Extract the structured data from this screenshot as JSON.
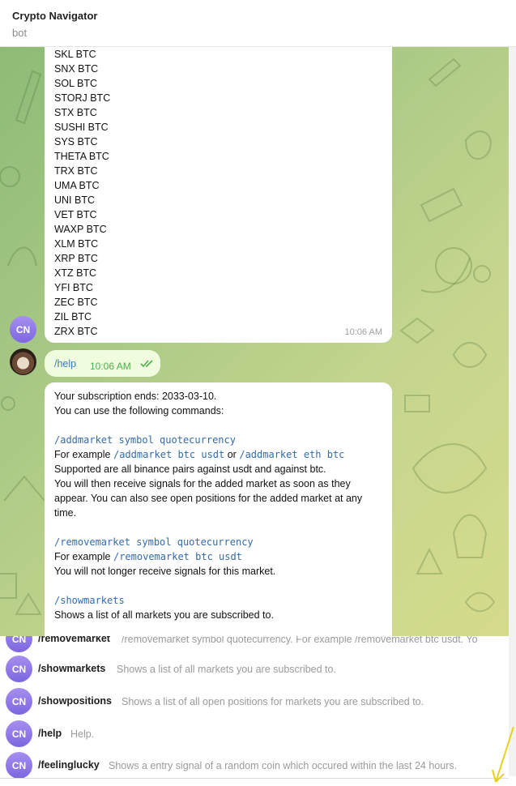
{
  "header": {
    "title": "Crypto Navigator",
    "subtitle": "bot"
  },
  "bot_avatar": "CN",
  "message1": {
    "lines": [
      "SKL BTC",
      "SNX BTC",
      "SOL BTC",
      "STORJ BTC",
      "STX BTC",
      "SUSHI BTC",
      "SYS BTC",
      "THETA BTC",
      "TRX BTC",
      "UMA BTC",
      "UNI BTC",
      "VET BTC",
      "WAXP BTC",
      "XLM BTC",
      "XRP BTC",
      "XTZ BTC",
      "YFI BTC",
      "ZEC BTC",
      "ZIL BTC",
      "ZRX BTC"
    ],
    "time": "10:06 AM"
  },
  "message2": {
    "text": "/help",
    "time": "10:06 AM"
  },
  "message3": {
    "line1": "Your subscription ends: 2033-03-10.",
    "line2": "You can use the following commands:",
    "addmarket_cmd": "/addmarket symbol quotecurrency",
    "addmarket_example_prefix": "For example",
    "addmarket_example1": "/addmarket btc usdt",
    "addmarket_example_or": "or",
    "addmarket_example2": "/addmarket eth btc",
    "addmarket_desc1": "Supported are all binance pairs against usdt and against btc.",
    "addmarket_desc2": "You will then receive signals for the added market as soon as they appear. You can also see open positions for the added market at any time.",
    "removemarket_cmd": "/removemarket symbol quotecurrency",
    "removemarket_example_prefix": "For example",
    "removemarket_example": "/removemarket btc usdt",
    "removemarket_desc": "You will not longer receive signals for this market.",
    "showmarkets_cmd": "/showmarkets",
    "showmarkets_desc": "Shows a list of all markets you are subscribed to."
  },
  "commands": [
    {
      "name": "/removemarket",
      "desc": "/removemarket symbol quotecurrency. For example /removemarket btc usdt. Yo"
    },
    {
      "name": "/showmarkets",
      "desc": "Shows a list of all markets you are subscribed to."
    },
    {
      "name": "/showpositions",
      "desc": "Shows a list of all open positions for markets you are subscribed to."
    },
    {
      "name": "/help",
      "desc": "Help."
    },
    {
      "name": "/feelinglucky",
      "desc": "Shows a entry signal of a random coin which occured within the last 24 hours."
    }
  ],
  "colors": {
    "accent_link": "#336ba8",
    "sent_bubble": "#effdde",
    "check_green": "#4fae4e",
    "avatar": "#8b74e6"
  }
}
